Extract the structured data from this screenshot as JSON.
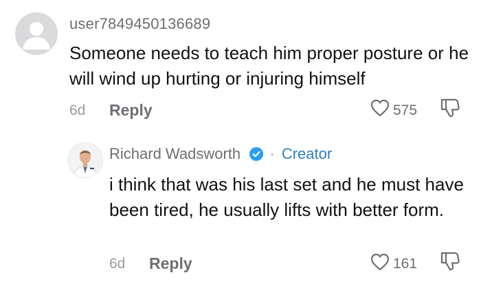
{
  "comment": {
    "username": "user7849450136689",
    "text": "Someone needs to teach him proper posture or he will wind up hurting or injuring himself",
    "date": "6d",
    "reply_label": "Reply",
    "like_count": "575"
  },
  "reply": {
    "author": "Richard Wadsworth",
    "separator": "·",
    "creator_label": "Creator",
    "text": "i think that was his last set and he must have been tired, he usually lifts with better form.",
    "date": "6d",
    "reply_label": "Reply",
    "like_count": "161"
  },
  "colors": {
    "verified_badge": "#2a9df4",
    "creator_label": "#2f7fbf",
    "avatar_placeholder": "#d9dadc"
  },
  "icons": {
    "like": "heart-outline-icon",
    "dislike": "thumbs-down-outline-icon",
    "verified": "verified-check-icon",
    "default_avatar": "default-avatar-icon"
  }
}
